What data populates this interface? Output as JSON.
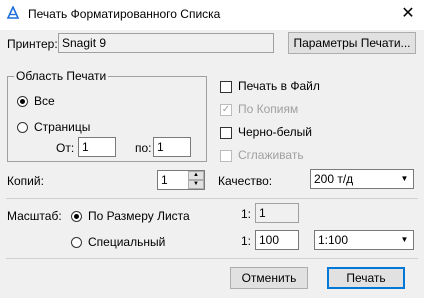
{
  "window": {
    "title": "Печать Форматированного Списка",
    "close_glyph": "✕"
  },
  "printer": {
    "label": "Принтер:",
    "value": "Snagit 9",
    "settings_button": "Параметры Печати..."
  },
  "print_area": {
    "group_label": "Область Печати",
    "all_label": "Все",
    "all_selected": true,
    "pages_label": "Страницы",
    "pages_selected": false,
    "from_label": "От:",
    "from_value": "1",
    "to_label": "по:",
    "to_value": "1"
  },
  "options": {
    "print_to_file": {
      "label": "Печать в Файл",
      "checked": false,
      "enabled": true
    },
    "by_copies": {
      "label": "По Копиям",
      "checked": true,
      "enabled": false
    },
    "black_white": {
      "label": "Черно-белый",
      "checked": false,
      "enabled": true
    },
    "smooth": {
      "label": "Сглаживать",
      "checked": false,
      "enabled": false
    }
  },
  "copies": {
    "label": "Копий:",
    "value": "1"
  },
  "quality": {
    "label": "Качество:",
    "value": "200 т/д"
  },
  "scale": {
    "label": "Масштаб:",
    "fit_label": "По Размеру Листа",
    "fit_selected": true,
    "custom_label": "Специальный",
    "custom_selected": false,
    "ratio_prefix_1": "1:",
    "ratio_value_1": "1",
    "ratio_prefix_2": "1:",
    "ratio_value_2": "100",
    "ratio_select": "1:100"
  },
  "footer": {
    "cancel_button": "Отменить",
    "print_button": "Печать"
  },
  "icons": {
    "app": "app-printer-icon",
    "close": "close-icon",
    "dropdown": "chevron-down-icon",
    "spin_up": "spin-up-icon",
    "spin_down": "spin-down-icon"
  }
}
